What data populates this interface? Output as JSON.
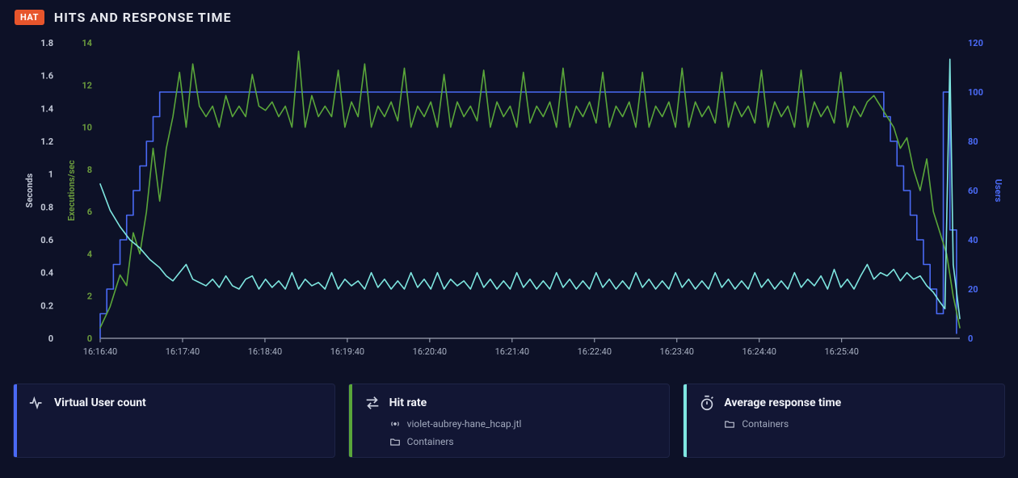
{
  "header": {
    "badge": "HAT",
    "title": "HITS AND RESPONSE TIME"
  },
  "chart_data": {
    "type": "line",
    "x_ticks": [
      "16:16:40",
      "16:17:40",
      "16:18:40",
      "16:19:40",
      "16:20:40",
      "16:21:40",
      "16:22:40",
      "16:23:40",
      "16:24:40",
      "16:25:40"
    ],
    "axes": {
      "y1": {
        "label": "Seconds",
        "ticks": [
          0,
          0.2,
          0.4,
          0.6,
          0.8,
          1,
          1.2,
          1.4,
          1.6,
          1.8
        ],
        "min": 0,
        "max": 1.8,
        "color": "#c2c8d6"
      },
      "y2": {
        "label": "Executions/sec",
        "ticks": [
          0,
          2,
          4,
          6,
          8,
          10,
          12,
          14
        ],
        "min": 0,
        "max": 14,
        "color": "#6a9a3d"
      },
      "y3": {
        "label": "Users",
        "ticks": [
          0,
          20,
          40,
          60,
          80,
          100,
          120
        ],
        "min": 0,
        "max": 120,
        "color": "#4a6af5"
      }
    },
    "series": [
      {
        "name": "Virtual User count",
        "axis": "y3",
        "kind": "step",
        "color": "#4a6af5",
        "points": [
          [
            0,
            10
          ],
          [
            4,
            20
          ],
          [
            8,
            30
          ],
          [
            12,
            40
          ],
          [
            16,
            50
          ],
          [
            20,
            60
          ],
          [
            24,
            70
          ],
          [
            28,
            80
          ],
          [
            32,
            90
          ],
          [
            36,
            100
          ],
          [
            470,
            100
          ],
          [
            474,
            90
          ],
          [
            478,
            80
          ],
          [
            482,
            70
          ],
          [
            486,
            60
          ],
          [
            490,
            50
          ],
          [
            494,
            40
          ],
          [
            498,
            30
          ],
          [
            502,
            20
          ],
          [
            506,
            10
          ],
          [
            510,
            100
          ],
          [
            514,
            44
          ],
          [
            518,
            2
          ]
        ]
      },
      {
        "name": "Hit rate",
        "axis": "y2",
        "kind": "line",
        "color": "#5aa63a",
        "points": [
          [
            0,
            0.5
          ],
          [
            6,
            1.5
          ],
          [
            12,
            3
          ],
          [
            16,
            2.5
          ],
          [
            20,
            5
          ],
          [
            24,
            4
          ],
          [
            28,
            6
          ],
          [
            32,
            9
          ],
          [
            36,
            6.5
          ],
          [
            40,
            9
          ],
          [
            44,
            10.5
          ],
          [
            48,
            12.6
          ],
          [
            52,
            10
          ],
          [
            56,
            13
          ],
          [
            60,
            11
          ],
          [
            64,
            10.5
          ],
          [
            68,
            11
          ],
          [
            72,
            10
          ],
          [
            76,
            11.5
          ],
          [
            80,
            10.5
          ],
          [
            84,
            11
          ],
          [
            88,
            10.5
          ],
          [
            92,
            12.5
          ],
          [
            96,
            11
          ],
          [
            100,
            10.8
          ],
          [
            104,
            11.2
          ],
          [
            108,
            10.5
          ],
          [
            112,
            11
          ],
          [
            116,
            10
          ],
          [
            120,
            13.6
          ],
          [
            124,
            10
          ],
          [
            128,
            11.5
          ],
          [
            132,
            10.5
          ],
          [
            136,
            11
          ],
          [
            140,
            10.5
          ],
          [
            144,
            12.7
          ],
          [
            148,
            10
          ],
          [
            152,
            11.2
          ],
          [
            156,
            10.5
          ],
          [
            160,
            13
          ],
          [
            164,
            10
          ],
          [
            168,
            11
          ],
          [
            172,
            10.5
          ],
          [
            176,
            11.2
          ],
          [
            180,
            10.3
          ],
          [
            184,
            12.8
          ],
          [
            188,
            10
          ],
          [
            192,
            11
          ],
          [
            196,
            10.5
          ],
          [
            200,
            11.2
          ],
          [
            204,
            10
          ],
          [
            208,
            12.5
          ],
          [
            212,
            10
          ],
          [
            216,
            11.2
          ],
          [
            220,
            10.5
          ],
          [
            224,
            11
          ],
          [
            228,
            10.3
          ],
          [
            232,
            12.7
          ],
          [
            236,
            10
          ],
          [
            240,
            11.2
          ],
          [
            244,
            10.5
          ],
          [
            248,
            11
          ],
          [
            252,
            10
          ],
          [
            256,
            12.6
          ],
          [
            260,
            10.2
          ],
          [
            264,
            11
          ],
          [
            268,
            10.5
          ],
          [
            272,
            11.2
          ],
          [
            276,
            10
          ],
          [
            280,
            12.8
          ],
          [
            284,
            10
          ],
          [
            288,
            11
          ],
          [
            292,
            10.5
          ],
          [
            296,
            11.2
          ],
          [
            300,
            10.2
          ],
          [
            304,
            12.6
          ],
          [
            308,
            10
          ],
          [
            312,
            11
          ],
          [
            316,
            10.5
          ],
          [
            320,
            11.2
          ],
          [
            324,
            10
          ],
          [
            328,
            12.6
          ],
          [
            332,
            10
          ],
          [
            336,
            11
          ],
          [
            340,
            10.5
          ],
          [
            344,
            11.2
          ],
          [
            348,
            10
          ],
          [
            352,
            12.8
          ],
          [
            356,
            10
          ],
          [
            360,
            11.2
          ],
          [
            364,
            10.5
          ],
          [
            368,
            11
          ],
          [
            372,
            10.2
          ],
          [
            376,
            12.6
          ],
          [
            380,
            10
          ],
          [
            384,
            11.2
          ],
          [
            388,
            10.5
          ],
          [
            392,
            11
          ],
          [
            396,
            10.2
          ],
          [
            400,
            12.7
          ],
          [
            404,
            10
          ],
          [
            408,
            11.2
          ],
          [
            412,
            10.5
          ],
          [
            416,
            11
          ],
          [
            420,
            10
          ],
          [
            424,
            12.7
          ],
          [
            428,
            10
          ],
          [
            432,
            11.2
          ],
          [
            436,
            10.5
          ],
          [
            440,
            11
          ],
          [
            444,
            10.2
          ],
          [
            448,
            12.6
          ],
          [
            452,
            10
          ],
          [
            456,
            11
          ],
          [
            460,
            10.5
          ],
          [
            464,
            11.2
          ],
          [
            468,
            11.5
          ],
          [
            472,
            11
          ],
          [
            476,
            10.5
          ],
          [
            480,
            10
          ],
          [
            484,
            9
          ],
          [
            488,
            9.5
          ],
          [
            492,
            8
          ],
          [
            496,
            7
          ],
          [
            500,
            8.5
          ],
          [
            504,
            6
          ],
          [
            508,
            5
          ],
          [
            512,
            4
          ],
          [
            516,
            2
          ],
          [
            520,
            0.5
          ]
        ]
      },
      {
        "name": "Average response time",
        "axis": "y1",
        "kind": "line",
        "color": "#7ee6e0",
        "points": [
          [
            0,
            0.94
          ],
          [
            6,
            0.78
          ],
          [
            12,
            0.68
          ],
          [
            18,
            0.6
          ],
          [
            24,
            0.55
          ],
          [
            30,
            0.48
          ],
          [
            36,
            0.43
          ],
          [
            40,
            0.38
          ],
          [
            44,
            0.35
          ],
          [
            48,
            0.4
          ],
          [
            52,
            0.45
          ],
          [
            56,
            0.36
          ],
          [
            60,
            0.34
          ],
          [
            64,
            0.32
          ],
          [
            68,
            0.36
          ],
          [
            72,
            0.31
          ],
          [
            76,
            0.38
          ],
          [
            80,
            0.32
          ],
          [
            84,
            0.3
          ],
          [
            88,
            0.36
          ],
          [
            92,
            0.38
          ],
          [
            96,
            0.3
          ],
          [
            100,
            0.36
          ],
          [
            104,
            0.31
          ],
          [
            108,
            0.35
          ],
          [
            112,
            0.3
          ],
          [
            116,
            0.4
          ],
          [
            120,
            0.3
          ],
          [
            124,
            0.36
          ],
          [
            128,
            0.32
          ],
          [
            132,
            0.34
          ],
          [
            136,
            0.3
          ],
          [
            140,
            0.4
          ],
          [
            144,
            0.3
          ],
          [
            148,
            0.36
          ],
          [
            152,
            0.32
          ],
          [
            156,
            0.35
          ],
          [
            160,
            0.3
          ],
          [
            164,
            0.4
          ],
          [
            168,
            0.31
          ],
          [
            172,
            0.36
          ],
          [
            176,
            0.3
          ],
          [
            180,
            0.35
          ],
          [
            184,
            0.3
          ],
          [
            188,
            0.4
          ],
          [
            192,
            0.31
          ],
          [
            196,
            0.36
          ],
          [
            200,
            0.3
          ],
          [
            204,
            0.4
          ],
          [
            208,
            0.3
          ],
          [
            212,
            0.36
          ],
          [
            216,
            0.32
          ],
          [
            220,
            0.35
          ],
          [
            224,
            0.3
          ],
          [
            228,
            0.4
          ],
          [
            232,
            0.31
          ],
          [
            236,
            0.36
          ],
          [
            240,
            0.3
          ],
          [
            244,
            0.35
          ],
          [
            248,
            0.3
          ],
          [
            252,
            0.4
          ],
          [
            256,
            0.31
          ],
          [
            260,
            0.36
          ],
          [
            264,
            0.3
          ],
          [
            268,
            0.35
          ],
          [
            272,
            0.3
          ],
          [
            276,
            0.4
          ],
          [
            280,
            0.31
          ],
          [
            284,
            0.36
          ],
          [
            288,
            0.3
          ],
          [
            292,
            0.35
          ],
          [
            296,
            0.3
          ],
          [
            300,
            0.4
          ],
          [
            304,
            0.31
          ],
          [
            308,
            0.36
          ],
          [
            312,
            0.3
          ],
          [
            316,
            0.35
          ],
          [
            320,
            0.3
          ],
          [
            324,
            0.4
          ],
          [
            328,
            0.31
          ],
          [
            332,
            0.36
          ],
          [
            336,
            0.3
          ],
          [
            340,
            0.35
          ],
          [
            344,
            0.3
          ],
          [
            348,
            0.4
          ],
          [
            352,
            0.31
          ],
          [
            356,
            0.36
          ],
          [
            360,
            0.3
          ],
          [
            364,
            0.35
          ],
          [
            368,
            0.3
          ],
          [
            372,
            0.4
          ],
          [
            376,
            0.31
          ],
          [
            380,
            0.36
          ],
          [
            384,
            0.3
          ],
          [
            388,
            0.35
          ],
          [
            392,
            0.3
          ],
          [
            396,
            0.4
          ],
          [
            400,
            0.31
          ],
          [
            404,
            0.36
          ],
          [
            408,
            0.3
          ],
          [
            412,
            0.35
          ],
          [
            416,
            0.3
          ],
          [
            420,
            0.4
          ],
          [
            424,
            0.31
          ],
          [
            428,
            0.36
          ],
          [
            432,
            0.32
          ],
          [
            436,
            0.38
          ],
          [
            440,
            0.3
          ],
          [
            444,
            0.42
          ],
          [
            448,
            0.31
          ],
          [
            452,
            0.36
          ],
          [
            456,
            0.3
          ],
          [
            460,
            0.38
          ],
          [
            464,
            0.45
          ],
          [
            468,
            0.36
          ],
          [
            472,
            0.4
          ],
          [
            476,
            0.38
          ],
          [
            480,
            0.42
          ],
          [
            484,
            0.35
          ],
          [
            488,
            0.4
          ],
          [
            492,
            0.36
          ],
          [
            496,
            0.38
          ],
          [
            500,
            0.32
          ],
          [
            504,
            0.28
          ],
          [
            508,
            0.22
          ],
          [
            511,
            0.18
          ],
          [
            514,
            1.7
          ],
          [
            516,
            0.45
          ],
          [
            520,
            0.12
          ]
        ]
      }
    ]
  },
  "cards": [
    {
      "accent": "accent-blue",
      "icon": "pulse-icon",
      "title": "Virtual User count",
      "subs": []
    },
    {
      "accent": "accent-green",
      "icon": "arrows-icon",
      "title": "Hit rate",
      "subs": [
        {
          "icon": "radio-icon",
          "label": "violet-aubrey-hane_hcap.jtl"
        },
        {
          "icon": "folder-icon",
          "label": "Containers"
        }
      ]
    },
    {
      "accent": "accent-cyan",
      "icon": "stopwatch-icon",
      "title": "Average response time",
      "subs": [
        {
          "icon": "folder-icon",
          "label": "Containers"
        }
      ]
    }
  ]
}
